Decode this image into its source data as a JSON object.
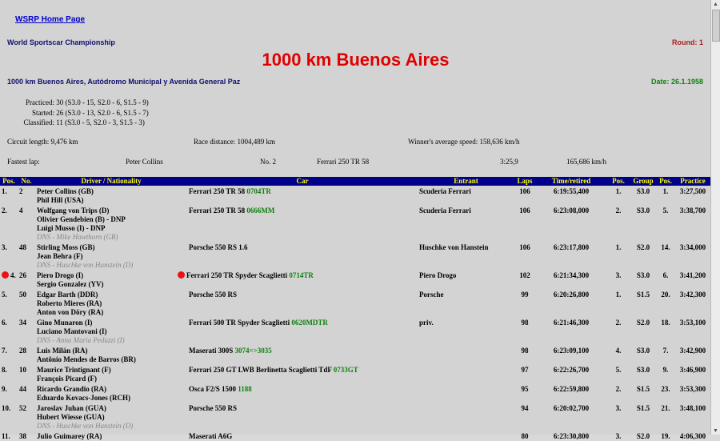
{
  "header": {
    "home_link": "WSRP Home Page",
    "championship": "World Sportscar Championship",
    "round": "Round: 1",
    "race_title": "1000 km Buenos Aires",
    "venue": "1000 km Buenos Aires, Autódromo Municipal y Avenida General Paz",
    "date": "Date: 26.1.1958"
  },
  "stats": {
    "practiced_label": "Practiced:",
    "practiced": "30 (S3.0 - 15, S2.0 - 6, S1.5 - 9)",
    "started_label": "Started:",
    "started": "26 (S3.0 - 13, S2.0 - 6, S1.5 - 7)",
    "classified_label": "Classified:",
    "classified": "11 (S3.0 - 5, S2.0 - 3, S1.5 - 3)"
  },
  "info": {
    "circuit_length": "Circuit length: 9,476 km",
    "race_distance": "Race distance: 1004,489 km",
    "winner_speed": "Winner's average speed: 158,636 km/h"
  },
  "fastest": {
    "label": "Fastest lap:",
    "driver": "Peter Collins",
    "number": "No. 2",
    "car": "Ferrari 250 TR 58",
    "time": "3:25,9",
    "speed": "165,686 km/h"
  },
  "table": {
    "columns": [
      "Pos.",
      "No.",
      "Driver / Nationality",
      "Car",
      "Entrant",
      "Laps",
      "Time/retired",
      "Pos.",
      "Group",
      "Pos.",
      "Practice"
    ],
    "rows": [
      {
        "pos": "1.",
        "no": "2",
        "drivers": [
          "Peter Collins (GB)",
          "Phil Hill (USA)"
        ],
        "dns": "",
        "car": "Ferrari 250 TR 58",
        "chassis": "0704TR",
        "entrant": "Scuderia Ferrari",
        "laps": "106",
        "time": "6:19:55,400",
        "cpos": "1.",
        "group": "S3.0",
        "ppos": "1.",
        "practice": "3:27,500",
        "marked": false
      },
      {
        "pos": "2.",
        "no": "4",
        "drivers": [
          "Wolfgang von Trips (D)",
          "Olivier Gendebien (B) - DNP",
          "Luigi Musso (I) - DNP"
        ],
        "dns": "DNS - Mike Hawthorn (GB)",
        "car": "Ferrari 250 TR 58",
        "chassis": "0666MM",
        "entrant": "Scuderia Ferrari",
        "laps": "106",
        "time": "6:23:08,000",
        "cpos": "2.",
        "group": "S3.0",
        "ppos": "5.",
        "practice": "3:38,700",
        "marked": false
      },
      {
        "pos": "3.",
        "no": "48",
        "drivers": [
          "Stirling Moss (GB)",
          "Jean Behra (F)"
        ],
        "dns": "DNS - Huschke von Hanstein (D)",
        "car": "Porsche 550 RS 1.6",
        "chassis": "",
        "entrant": "Huschke von Hanstein",
        "laps": "106",
        "time": "6:23:17,800",
        "cpos": "1.",
        "group": "S2.0",
        "ppos": "14.",
        "practice": "3:34,000",
        "marked": false
      },
      {
        "pos": "4.",
        "no": "26",
        "drivers": [
          "Piero Drogo (I)",
          "Sergio Gonzalez (YV)"
        ],
        "dns": "",
        "car": "Ferrari 250 TR Spyder Scaglietti",
        "chassis": "0714TR",
        "entrant": "Piero Drogo",
        "laps": "102",
        "time": "6:21:34,300",
        "cpos": "3.",
        "group": "S3.0",
        "ppos": "6.",
        "practice": "3:41,200",
        "marked": true
      },
      {
        "pos": "5.",
        "no": "50",
        "drivers": [
          "Edgar Barth (DDR)",
          "Roberto Mieres (RA)",
          "Anton von Döry (RA)"
        ],
        "dns": "",
        "car": "Porsche 550 RS",
        "chassis": "",
        "entrant": "Porsche",
        "laps": "99",
        "time": "6:20:26,800",
        "cpos": "1.",
        "group": "S1.5",
        "ppos": "20.",
        "practice": "3:42,300",
        "marked": false
      },
      {
        "pos": "6.",
        "no": "34",
        "drivers": [
          "Gino Munaron (I)",
          "Luciano Mantovani (I)"
        ],
        "dns": "DNS - Anna Maria Peduzzi (I)",
        "car": "Ferrari 500 TR Spyder Scaglietti",
        "chassis": "0620MDTR",
        "entrant": "priv.",
        "laps": "98",
        "time": "6:21:46,300",
        "cpos": "2.",
        "group": "S2.0",
        "ppos": "18.",
        "practice": "3:53,100",
        "marked": false
      },
      {
        "pos": "7.",
        "no": "28",
        "drivers": [
          "Luis Milán (RA)",
          "Antônio Mendes de Barros (BR)"
        ],
        "dns": "",
        "car": "Maserati 300S",
        "chassis": "3074=>3035",
        "entrant": "",
        "laps": "98",
        "time": "6:23:09,100",
        "cpos": "4.",
        "group": "S3.0",
        "ppos": "7.",
        "practice": "3:42,900",
        "marked": false
      },
      {
        "pos": "8.",
        "no": "10",
        "drivers": [
          "Maurice Trintignant (F)",
          "François Picard (F)"
        ],
        "dns": "",
        "car": "Ferrari 250 GT LWB Berlinetta Scaglietti TdF",
        "chassis": "0733GT",
        "entrant": "",
        "laps": "97",
        "time": "6:22:26,700",
        "cpos": "5.",
        "group": "S3.0",
        "ppos": "9.",
        "practice": "3:46,900",
        "marked": false
      },
      {
        "pos": "9.",
        "no": "44",
        "drivers": [
          "Ricardo Grandio (RA)",
          "Eduardo Kovacs-Jones (RCH)"
        ],
        "dns": "",
        "car": "Osca F2/S 1500",
        "chassis": "1188",
        "entrant": "",
        "laps": "95",
        "time": "6:22:59,800",
        "cpos": "2.",
        "group": "S1.5",
        "ppos": "23.",
        "practice": "3:53,300",
        "marked": false
      },
      {
        "pos": "10.",
        "no": "52",
        "drivers": [
          "Jaroslav Juhan (GUA)",
          "Hubert Wiesse (GUA)"
        ],
        "dns": "DNS - Huschke von Hanstein (D)",
        "car": "Porsche 550 RS",
        "chassis": "",
        "entrant": "",
        "laps": "94",
        "time": "6:20:02,700",
        "cpos": "3.",
        "group": "S1.5",
        "ppos": "21.",
        "practice": "3:48,100",
        "marked": false
      },
      {
        "pos": "11.",
        "no": "38",
        "drivers": [
          "Julio Guimarey (RA)"
        ],
        "dns": "",
        "car": "Maserati A6G",
        "chassis": "",
        "entrant": "",
        "laps": "80",
        "time": "6:23:30,800",
        "cpos": "3.",
        "group": "S2.0",
        "ppos": "19.",
        "practice": "4:06,300",
        "marked": false
      }
    ]
  }
}
